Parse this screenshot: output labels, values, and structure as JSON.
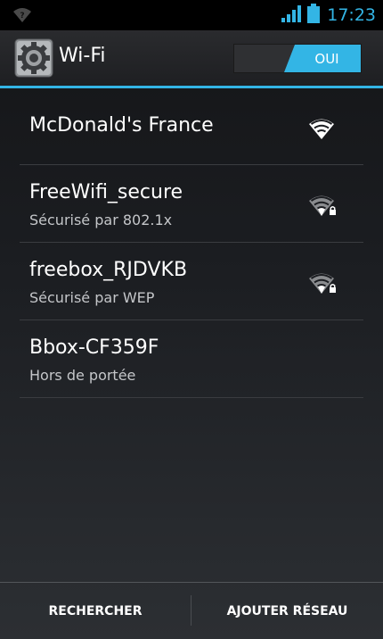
{
  "status_bar": {
    "time": "17:23",
    "icons": [
      "wifi-question-icon",
      "signal-strength-icon",
      "battery-icon"
    ]
  },
  "action_bar": {
    "title": "Wi-Fi",
    "icon": "settings-gear-icon",
    "toggle_label": "OUI",
    "toggle_on": true
  },
  "networks": [
    {
      "name": "McDonald's France",
      "status": "",
      "secured": false,
      "icon": "wifi-signal-icon"
    },
    {
      "name": "FreeWifi_secure",
      "status": "Sécurisé par 802.1x",
      "secured": true,
      "icon": "wifi-signal-lock-icon"
    },
    {
      "name": "freebox_RJDVKB",
      "status": "Sécurisé par WEP",
      "secured": true,
      "icon": "wifi-signal-lock-icon"
    },
    {
      "name": "Bbox-CF359F",
      "status": "Hors de portée",
      "secured": false,
      "icon": ""
    }
  ],
  "bottom_bar": {
    "search_label": "RECHERCHER",
    "add_network_label": "AJOUTER RÉSEAU"
  },
  "colors": {
    "accent": "#33b5e5",
    "background": "#1b1d21"
  }
}
